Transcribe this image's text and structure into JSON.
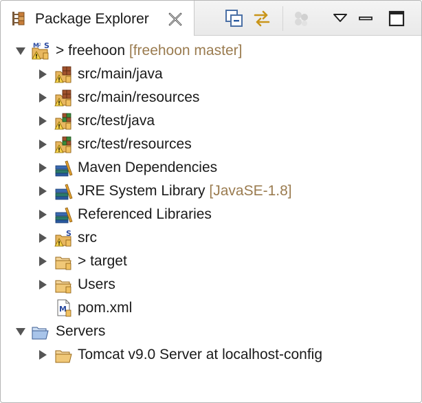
{
  "view": {
    "title": "Package Explorer",
    "toolbar": {
      "collapse_all": "collapse-all",
      "link_with_editor": "link-with-editor",
      "filters": "filters",
      "view_menu": "view-menu",
      "minimize": "minimize",
      "maximize": "maximize"
    }
  },
  "tree": {
    "project": {
      "prefix": "> ",
      "name": "freehoon",
      "decoration": "[freehoon master]"
    },
    "items": [
      {
        "label": "src/main/java",
        "decoration": ""
      },
      {
        "label": "src/main/resources",
        "decoration": ""
      },
      {
        "label": "src/test/java",
        "decoration": ""
      },
      {
        "label": "src/test/resources",
        "decoration": ""
      },
      {
        "label": "Maven Dependencies",
        "decoration": ""
      },
      {
        "label": "JRE System Library",
        "decoration": "[JavaSE-1.8]"
      },
      {
        "label": "Referenced Libraries",
        "decoration": ""
      },
      {
        "label": "src",
        "decoration": ""
      },
      {
        "label": "> target",
        "decoration": ""
      },
      {
        "label": "Users",
        "decoration": ""
      },
      {
        "label": "pom.xml",
        "decoration": ""
      }
    ],
    "servers": {
      "name": "Servers"
    },
    "server_items": [
      {
        "label": "Tomcat v9.0 Server at localhost-config"
      }
    ]
  },
  "colors": {
    "decoration": "#9a7b4f",
    "folder": "#e8b760",
    "library_books": "#2a7a6a",
    "package": "#a0522d",
    "test_package": "#3a8a3a"
  }
}
